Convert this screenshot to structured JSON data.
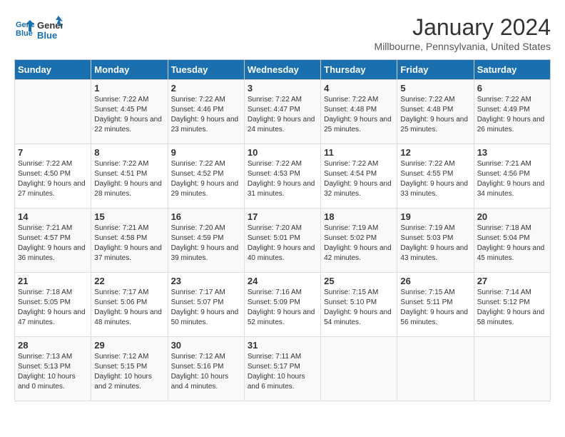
{
  "header": {
    "logo_line1": "General",
    "logo_line2": "Blue",
    "month": "January 2024",
    "location": "Millbourne, Pennsylvania, United States"
  },
  "days_of_week": [
    "Sunday",
    "Monday",
    "Tuesday",
    "Wednesday",
    "Thursday",
    "Friday",
    "Saturday"
  ],
  "weeks": [
    [
      {
        "day": "",
        "sunrise": "",
        "sunset": "",
        "daylight": ""
      },
      {
        "day": "1",
        "sunrise": "7:22 AM",
        "sunset": "4:45 PM",
        "daylight": "9 hours and 22 minutes."
      },
      {
        "day": "2",
        "sunrise": "7:22 AM",
        "sunset": "4:46 PM",
        "daylight": "9 hours and 23 minutes."
      },
      {
        "day": "3",
        "sunrise": "7:22 AM",
        "sunset": "4:47 PM",
        "daylight": "9 hours and 24 minutes."
      },
      {
        "day": "4",
        "sunrise": "7:22 AM",
        "sunset": "4:48 PM",
        "daylight": "9 hours and 25 minutes."
      },
      {
        "day": "5",
        "sunrise": "7:22 AM",
        "sunset": "4:48 PM",
        "daylight": "9 hours and 25 minutes."
      },
      {
        "day": "6",
        "sunrise": "7:22 AM",
        "sunset": "4:49 PM",
        "daylight": "9 hours and 26 minutes."
      }
    ],
    [
      {
        "day": "7",
        "sunrise": "7:22 AM",
        "sunset": "4:50 PM",
        "daylight": "9 hours and 27 minutes."
      },
      {
        "day": "8",
        "sunrise": "7:22 AM",
        "sunset": "4:51 PM",
        "daylight": "9 hours and 28 minutes."
      },
      {
        "day": "9",
        "sunrise": "7:22 AM",
        "sunset": "4:52 PM",
        "daylight": "9 hours and 29 minutes."
      },
      {
        "day": "10",
        "sunrise": "7:22 AM",
        "sunset": "4:53 PM",
        "daylight": "9 hours and 31 minutes."
      },
      {
        "day": "11",
        "sunrise": "7:22 AM",
        "sunset": "4:54 PM",
        "daylight": "9 hours and 32 minutes."
      },
      {
        "day": "12",
        "sunrise": "7:22 AM",
        "sunset": "4:55 PM",
        "daylight": "9 hours and 33 minutes."
      },
      {
        "day": "13",
        "sunrise": "7:21 AM",
        "sunset": "4:56 PM",
        "daylight": "9 hours and 34 minutes."
      }
    ],
    [
      {
        "day": "14",
        "sunrise": "7:21 AM",
        "sunset": "4:57 PM",
        "daylight": "9 hours and 36 minutes."
      },
      {
        "day": "15",
        "sunrise": "7:21 AM",
        "sunset": "4:58 PM",
        "daylight": "9 hours and 37 minutes."
      },
      {
        "day": "16",
        "sunrise": "7:20 AM",
        "sunset": "4:59 PM",
        "daylight": "9 hours and 39 minutes."
      },
      {
        "day": "17",
        "sunrise": "7:20 AM",
        "sunset": "5:01 PM",
        "daylight": "9 hours and 40 minutes."
      },
      {
        "day": "18",
        "sunrise": "7:19 AM",
        "sunset": "5:02 PM",
        "daylight": "9 hours and 42 minutes."
      },
      {
        "day": "19",
        "sunrise": "7:19 AM",
        "sunset": "5:03 PM",
        "daylight": "9 hours and 43 minutes."
      },
      {
        "day": "20",
        "sunrise": "7:18 AM",
        "sunset": "5:04 PM",
        "daylight": "9 hours and 45 minutes."
      }
    ],
    [
      {
        "day": "21",
        "sunrise": "7:18 AM",
        "sunset": "5:05 PM",
        "daylight": "9 hours and 47 minutes."
      },
      {
        "day": "22",
        "sunrise": "7:17 AM",
        "sunset": "5:06 PM",
        "daylight": "9 hours and 48 minutes."
      },
      {
        "day": "23",
        "sunrise": "7:17 AM",
        "sunset": "5:07 PM",
        "daylight": "9 hours and 50 minutes."
      },
      {
        "day": "24",
        "sunrise": "7:16 AM",
        "sunset": "5:09 PM",
        "daylight": "9 hours and 52 minutes."
      },
      {
        "day": "25",
        "sunrise": "7:15 AM",
        "sunset": "5:10 PM",
        "daylight": "9 hours and 54 minutes."
      },
      {
        "day": "26",
        "sunrise": "7:15 AM",
        "sunset": "5:11 PM",
        "daylight": "9 hours and 56 minutes."
      },
      {
        "day": "27",
        "sunrise": "7:14 AM",
        "sunset": "5:12 PM",
        "daylight": "9 hours and 58 minutes."
      }
    ],
    [
      {
        "day": "28",
        "sunrise": "7:13 AM",
        "sunset": "5:13 PM",
        "daylight": "10 hours and 0 minutes."
      },
      {
        "day": "29",
        "sunrise": "7:12 AM",
        "sunset": "5:15 PM",
        "daylight": "10 hours and 2 minutes."
      },
      {
        "day": "30",
        "sunrise": "7:12 AM",
        "sunset": "5:16 PM",
        "daylight": "10 hours and 4 minutes."
      },
      {
        "day": "31",
        "sunrise": "7:11 AM",
        "sunset": "5:17 PM",
        "daylight": "10 hours and 6 minutes."
      },
      {
        "day": "",
        "sunrise": "",
        "sunset": "",
        "daylight": ""
      },
      {
        "day": "",
        "sunrise": "",
        "sunset": "",
        "daylight": ""
      },
      {
        "day": "",
        "sunrise": "",
        "sunset": "",
        "daylight": ""
      }
    ]
  ],
  "labels": {
    "sunrise_prefix": "Sunrise: ",
    "sunset_prefix": "Sunset: ",
    "daylight_prefix": "Daylight: "
  }
}
